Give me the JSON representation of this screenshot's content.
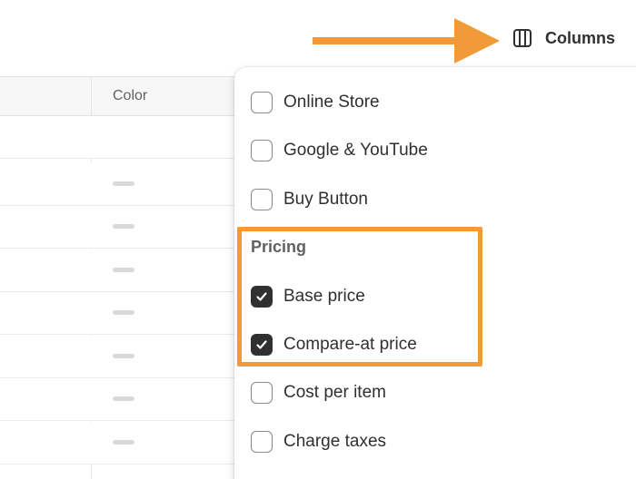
{
  "toolbar": {
    "columns_label": "Columns",
    "columns_icon": "columns-icon"
  },
  "annotation": {
    "arrow_color": "#F29A38",
    "box_color": "#F29A38"
  },
  "table": {
    "headers": [
      "Color"
    ],
    "rows": [
      "",
      "—",
      "—",
      "—",
      "—",
      "—",
      "—",
      "—"
    ]
  },
  "columns_menu": {
    "items": [
      {
        "label": "Online Store",
        "checked": false
      },
      {
        "label": "Google & YouTube",
        "checked": false
      },
      {
        "label": "Buy Button",
        "checked": false
      }
    ],
    "pricing_section": {
      "heading": "Pricing",
      "items": [
        {
          "label": "Base price",
          "checked": true
        },
        {
          "label": "Compare-at price",
          "checked": true
        },
        {
          "label": "Cost per item",
          "checked": false
        },
        {
          "label": "Charge taxes",
          "checked": false
        }
      ]
    }
  }
}
